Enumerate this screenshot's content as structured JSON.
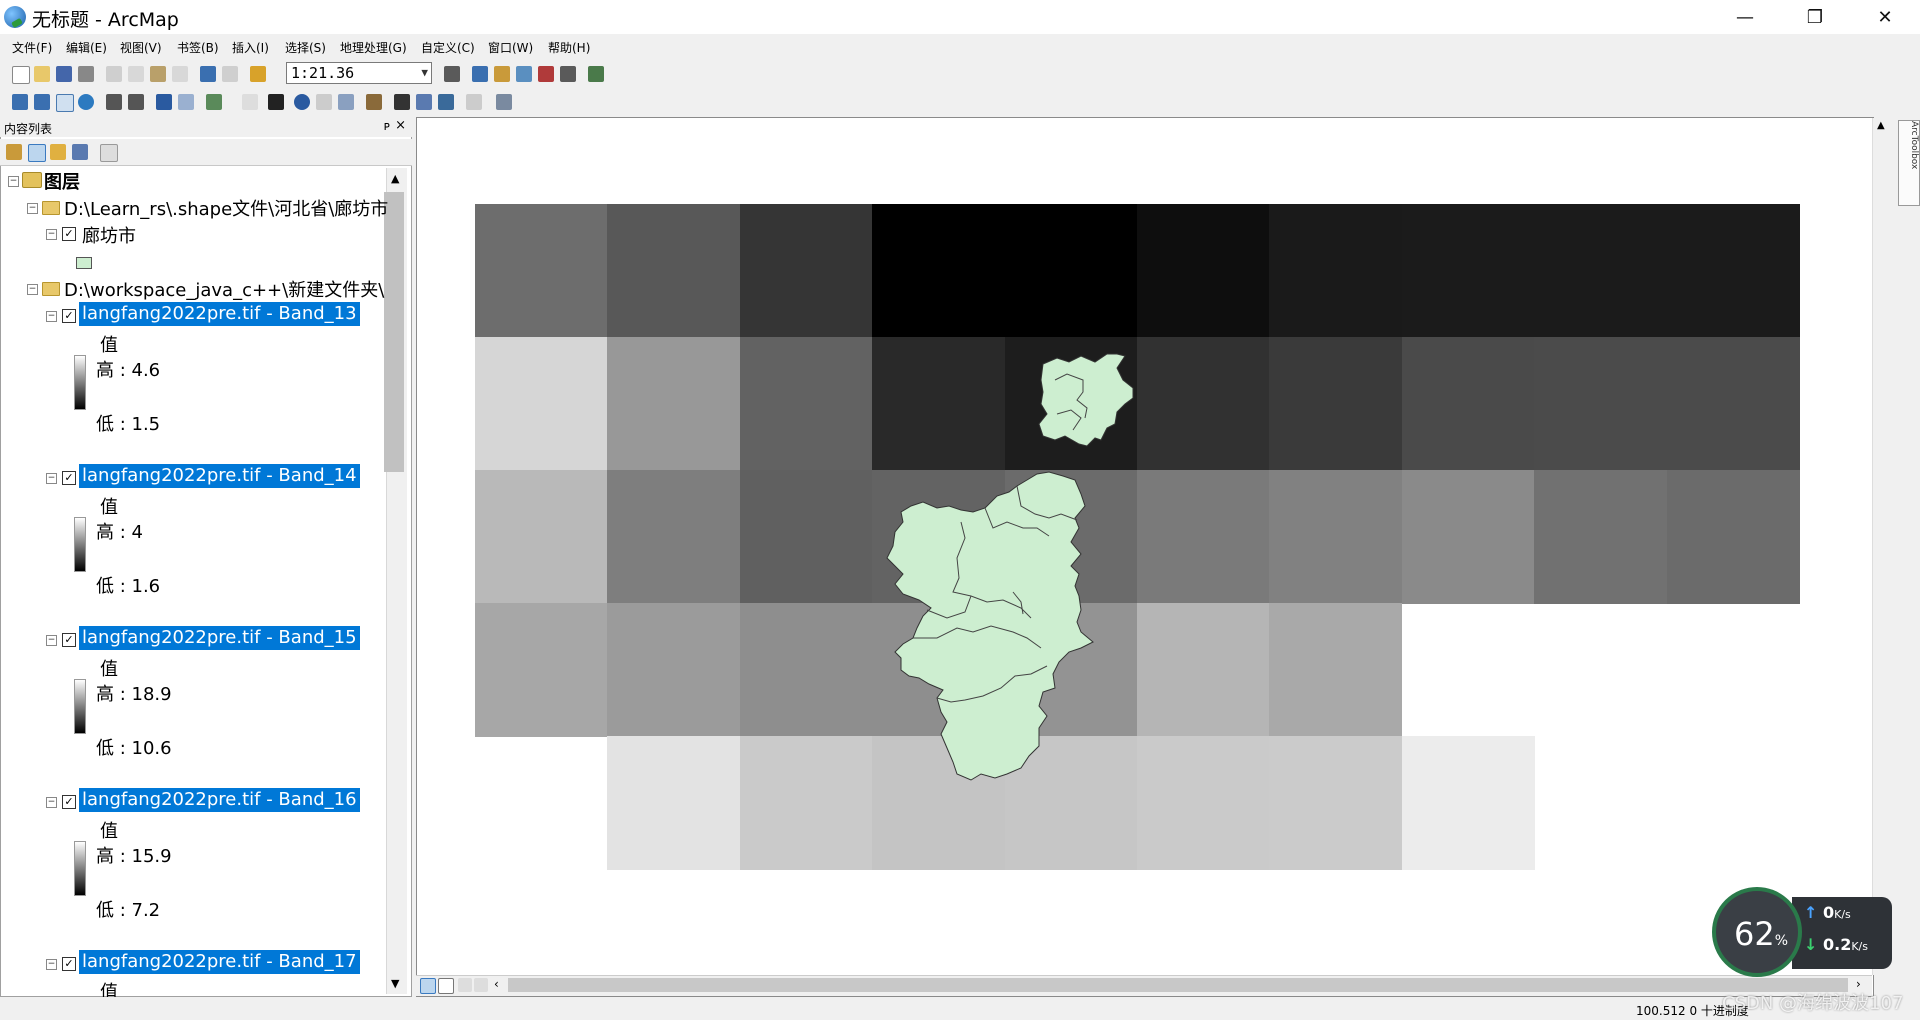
{
  "window": {
    "title": "无标题 - ArcMap",
    "minimize": "—",
    "restore": "❐",
    "close": "✕"
  },
  "menus": [
    "文件(F)",
    "编辑(E)",
    "视图(V)",
    "书签(B)",
    "插入(I)",
    "选择(S)",
    "地理处理(G)",
    "自定义(C)",
    "窗口(W)",
    "帮助(H)"
  ],
  "scale": {
    "value": "1:21.36"
  },
  "toc": {
    "title": "内容列表",
    "pin": "ᴘ",
    "close": "×",
    "root": "图层",
    "group1": "D:\\Learn_rs\\.shape文件\\河北省\\廊坊市",
    "layer_langfang": "廊坊市",
    "group2": "D:\\workspace_java_c++\\新建文件夹\\",
    "bands": [
      {
        "name": "langfang2022pre.tif - Band_13",
        "value_label": "值",
        "high": "高 : 4.6",
        "low": "低 : 1.5"
      },
      {
        "name": "langfang2022pre.tif - Band_14",
        "value_label": "值",
        "high": "高 : 4",
        "low": "低 : 1.6"
      },
      {
        "name": "langfang2022pre.tif - Band_15",
        "value_label": "值",
        "high": "高 : 18.9",
        "low": "低 : 10.6"
      },
      {
        "name": "langfang2022pre.tif - Band_16",
        "value_label": "值",
        "high": "高 : 15.9",
        "low": "低 : 7.2"
      },
      {
        "name": "langfang2022pre.tif - Band_17",
        "value_label": "值"
      }
    ]
  },
  "arctoolbox": "ArcToolbox",
  "status": {
    "coords": "100.512  0 十进制度"
  },
  "network": {
    "percent": "62",
    "percent_unit": "%",
    "up": "0",
    "up_unit": "K/s",
    "down": "0.2",
    "down_unit": "K/s"
  },
  "watermark": "CSDN @海绵波波107",
  "raster_rows": [
    [
      "#6d6d6d",
      "#585858",
      "#353535",
      "#000000",
      "#000000",
      "#0e0e0e",
      "#1a1a1a",
      "#1b1b1b",
      "#1b1b1b",
      "#1b1b1b"
    ],
    [
      "#d6d6d6",
      "#989898",
      "#626262",
      "#292929",
      "#1d1d1d",
      "#313131",
      "#3a3a3a",
      "#4a4a4a",
      "#4b4b4b",
      "#4b4b4b"
    ],
    [
      "#b9b9b9",
      "#7e7e7e",
      "#606060",
      "#636363",
      "#6b6b6b",
      "#7a7a7a",
      "#818181",
      "#8a8a8a",
      "#717171",
      "#6b6b6b"
    ],
    [
      "#a7a7a7",
      "#9b9b9b",
      "#8e8e8e",
      "#8e8e8e",
      "#939393",
      "#b5b5b5",
      "#a9a9a9",
      null,
      null,
      null
    ],
    [
      null,
      "#e3e3e3",
      "#cacaca",
      "#c4c4c4",
      "#c6c6c6",
      "#cacaca",
      "#cbcbcb",
      "#ececec",
      null,
      null
    ]
  ]
}
